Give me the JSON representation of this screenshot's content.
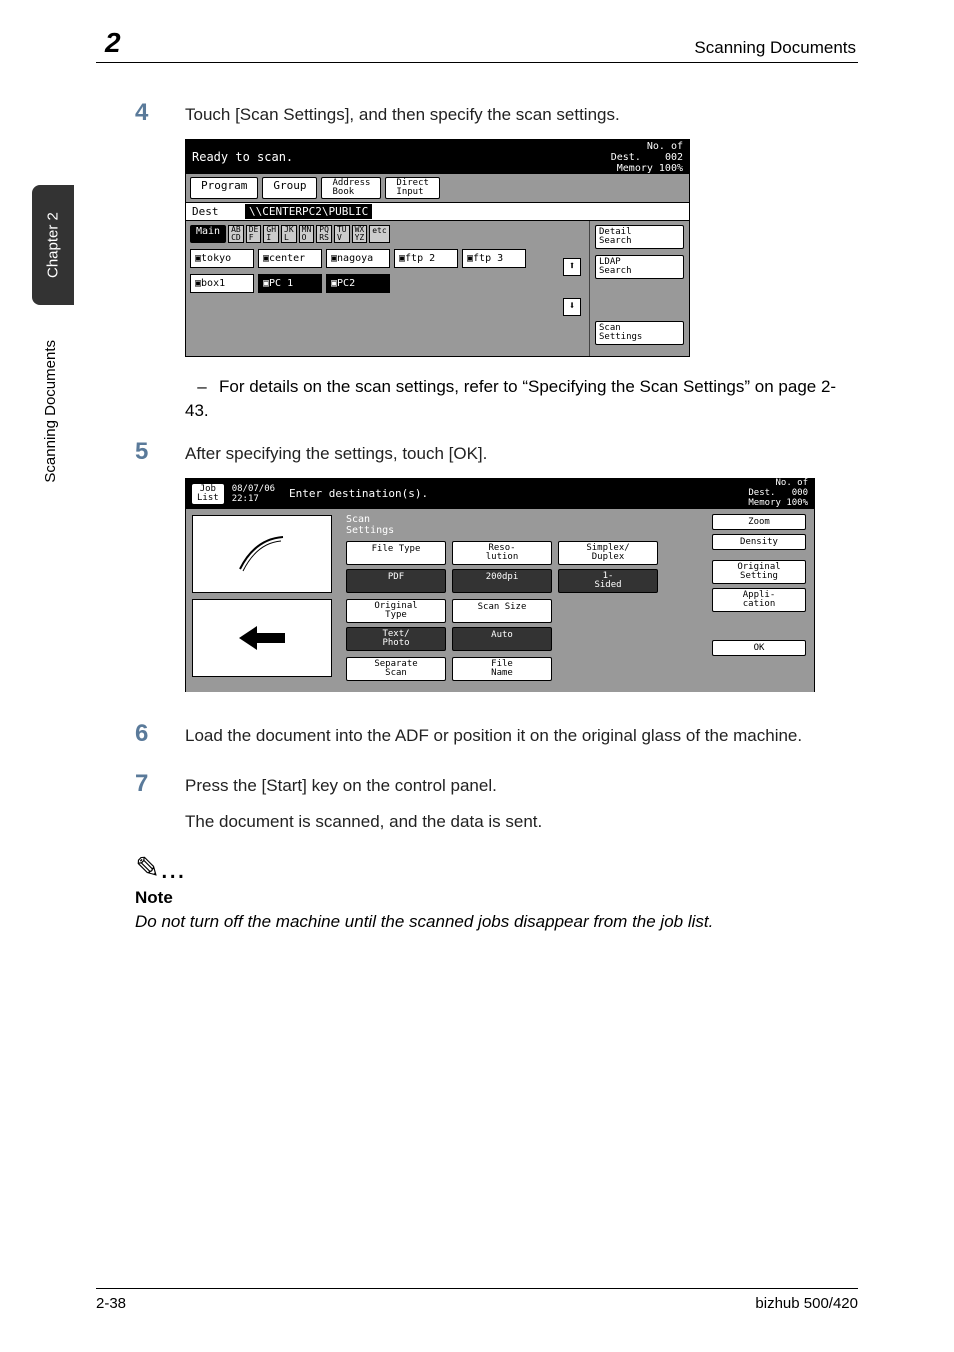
{
  "page": {
    "chapter_num": "2",
    "header_title": "Scanning Documents",
    "side_tab": "Chapter 2",
    "side_label": "Scanning Documents",
    "footer_left": "2-38",
    "footer_right": "bizhub 500/420"
  },
  "step4": {
    "num": "4",
    "text": "Touch [Scan Settings], and then specify the scan settings."
  },
  "screen1": {
    "ready": "Ready to scan.",
    "dest_count_label": "No. of\nDest.",
    "dest_count": "002",
    "memory": "Memory 100%",
    "tab_program": "Program",
    "tab_group": "Group",
    "tab_address": "Address\nBook",
    "tab_direct": "Direct\nInput",
    "dest_label": "Dest",
    "dest_value": "\\\\CENTERPC2\\PUBLIC",
    "main_btn": "Main",
    "alpha": [
      "AB\nCD",
      "DE\nF",
      "GH\nI",
      "JK\nL",
      "MN\nO",
      "PQ\nRS",
      "TU\nV",
      "WX\nYZ",
      "etc"
    ],
    "row1": [
      "tokyo",
      "center",
      "nagoya",
      "ftp 2",
      "ftp 3"
    ],
    "row2": [
      "box1",
      "PC 1",
      "PC2"
    ],
    "side_detail": "Detail\nSearch",
    "side_ldap": "LDAP\nSearch",
    "side_scan": "Scan\nSettings"
  },
  "sub4": {
    "text": "For details on the scan settings, refer to “Specifying the Scan Settings” on page 2-43."
  },
  "step5": {
    "num": "5",
    "text": "After specifying the settings, touch [OK]."
  },
  "screen2": {
    "joblist": "Job\nList",
    "datetime": "08/07/06\n22:17",
    "enter_dest": "Enter destination(s).",
    "dest_count_label": "No. of\nDest.",
    "dest_count": "000",
    "memory": "Memory 100%",
    "scan_settings": "Scan\nSettings",
    "file_type": "File Type",
    "pdf": "PDF",
    "resolution": "Reso-\nlution",
    "dpi": "200dpi",
    "simplex": "Simplex/\nDuplex",
    "sided": "1-\nSided",
    "original_type": "Original\nType",
    "text_photo": "Text/\nPhoto",
    "scan_size": "Scan Size",
    "auto": "Auto",
    "separate": "Separate\nScan",
    "file_name": "File\nName",
    "zoom": "Zoom",
    "density": "Density",
    "original_setting": "Original\nSetting",
    "application": "Appli-\ncation",
    "ok": "OK"
  },
  "step6": {
    "num": "6",
    "text": "Load the document into the ADF or position it on the original glass of the machine."
  },
  "step7": {
    "num": "7",
    "text": "Press the [Start] key on the control panel.",
    "result": "The document is scanned, and the data is sent."
  },
  "note": {
    "icon": "✎...",
    "heading": "Note",
    "text": "Do not turn off the machine until the scanned jobs disappear from the job list."
  }
}
